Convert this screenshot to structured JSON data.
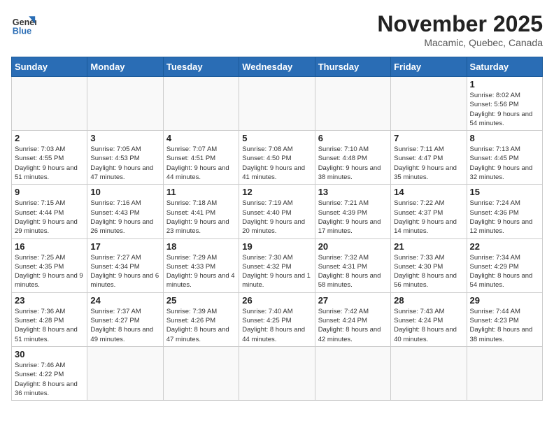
{
  "logo": {
    "line1": "General",
    "line2": "Blue"
  },
  "title": "November 2025",
  "location": "Macamic, Quebec, Canada",
  "days_of_week": [
    "Sunday",
    "Monday",
    "Tuesday",
    "Wednesday",
    "Thursday",
    "Friday",
    "Saturday"
  ],
  "weeks": [
    [
      {
        "day": "",
        "info": ""
      },
      {
        "day": "",
        "info": ""
      },
      {
        "day": "",
        "info": ""
      },
      {
        "day": "",
        "info": ""
      },
      {
        "day": "",
        "info": ""
      },
      {
        "day": "",
        "info": ""
      },
      {
        "day": "1",
        "info": "Sunrise: 8:02 AM\nSunset: 5:56 PM\nDaylight: 9 hours and 54 minutes."
      }
    ],
    [
      {
        "day": "2",
        "info": "Sunrise: 7:03 AM\nSunset: 4:55 PM\nDaylight: 9 hours and 51 minutes."
      },
      {
        "day": "3",
        "info": "Sunrise: 7:05 AM\nSunset: 4:53 PM\nDaylight: 9 hours and 47 minutes."
      },
      {
        "day": "4",
        "info": "Sunrise: 7:07 AM\nSunset: 4:51 PM\nDaylight: 9 hours and 44 minutes."
      },
      {
        "day": "5",
        "info": "Sunrise: 7:08 AM\nSunset: 4:50 PM\nDaylight: 9 hours and 41 minutes."
      },
      {
        "day": "6",
        "info": "Sunrise: 7:10 AM\nSunset: 4:48 PM\nDaylight: 9 hours and 38 minutes."
      },
      {
        "day": "7",
        "info": "Sunrise: 7:11 AM\nSunset: 4:47 PM\nDaylight: 9 hours and 35 minutes."
      },
      {
        "day": "8",
        "info": "Sunrise: 7:13 AM\nSunset: 4:45 PM\nDaylight: 9 hours and 32 minutes."
      }
    ],
    [
      {
        "day": "9",
        "info": "Sunrise: 7:15 AM\nSunset: 4:44 PM\nDaylight: 9 hours and 29 minutes."
      },
      {
        "day": "10",
        "info": "Sunrise: 7:16 AM\nSunset: 4:43 PM\nDaylight: 9 hours and 26 minutes."
      },
      {
        "day": "11",
        "info": "Sunrise: 7:18 AM\nSunset: 4:41 PM\nDaylight: 9 hours and 23 minutes."
      },
      {
        "day": "12",
        "info": "Sunrise: 7:19 AM\nSunset: 4:40 PM\nDaylight: 9 hours and 20 minutes."
      },
      {
        "day": "13",
        "info": "Sunrise: 7:21 AM\nSunset: 4:39 PM\nDaylight: 9 hours and 17 minutes."
      },
      {
        "day": "14",
        "info": "Sunrise: 7:22 AM\nSunset: 4:37 PM\nDaylight: 9 hours and 14 minutes."
      },
      {
        "day": "15",
        "info": "Sunrise: 7:24 AM\nSunset: 4:36 PM\nDaylight: 9 hours and 12 minutes."
      }
    ],
    [
      {
        "day": "16",
        "info": "Sunrise: 7:25 AM\nSunset: 4:35 PM\nDaylight: 9 hours and 9 minutes."
      },
      {
        "day": "17",
        "info": "Sunrise: 7:27 AM\nSunset: 4:34 PM\nDaylight: 9 hours and 6 minutes."
      },
      {
        "day": "18",
        "info": "Sunrise: 7:29 AM\nSunset: 4:33 PM\nDaylight: 9 hours and 4 minutes."
      },
      {
        "day": "19",
        "info": "Sunrise: 7:30 AM\nSunset: 4:32 PM\nDaylight: 9 hours and 1 minute."
      },
      {
        "day": "20",
        "info": "Sunrise: 7:32 AM\nSunset: 4:31 PM\nDaylight: 8 hours and 58 minutes."
      },
      {
        "day": "21",
        "info": "Sunrise: 7:33 AM\nSunset: 4:30 PM\nDaylight: 8 hours and 56 minutes."
      },
      {
        "day": "22",
        "info": "Sunrise: 7:34 AM\nSunset: 4:29 PM\nDaylight: 8 hours and 54 minutes."
      }
    ],
    [
      {
        "day": "23",
        "info": "Sunrise: 7:36 AM\nSunset: 4:28 PM\nDaylight: 8 hours and 51 minutes."
      },
      {
        "day": "24",
        "info": "Sunrise: 7:37 AM\nSunset: 4:27 PM\nDaylight: 8 hours and 49 minutes."
      },
      {
        "day": "25",
        "info": "Sunrise: 7:39 AM\nSunset: 4:26 PM\nDaylight: 8 hours and 47 minutes."
      },
      {
        "day": "26",
        "info": "Sunrise: 7:40 AM\nSunset: 4:25 PM\nDaylight: 8 hours and 44 minutes."
      },
      {
        "day": "27",
        "info": "Sunrise: 7:42 AM\nSunset: 4:24 PM\nDaylight: 8 hours and 42 minutes."
      },
      {
        "day": "28",
        "info": "Sunrise: 7:43 AM\nSunset: 4:24 PM\nDaylight: 8 hours and 40 minutes."
      },
      {
        "day": "29",
        "info": "Sunrise: 7:44 AM\nSunset: 4:23 PM\nDaylight: 8 hours and 38 minutes."
      }
    ],
    [
      {
        "day": "30",
        "info": "Sunrise: 7:46 AM\nSunset: 4:22 PM\nDaylight: 8 hours and 36 minutes."
      },
      {
        "day": "",
        "info": ""
      },
      {
        "day": "",
        "info": ""
      },
      {
        "day": "",
        "info": ""
      },
      {
        "day": "",
        "info": ""
      },
      {
        "day": "",
        "info": ""
      },
      {
        "day": "",
        "info": ""
      }
    ]
  ]
}
